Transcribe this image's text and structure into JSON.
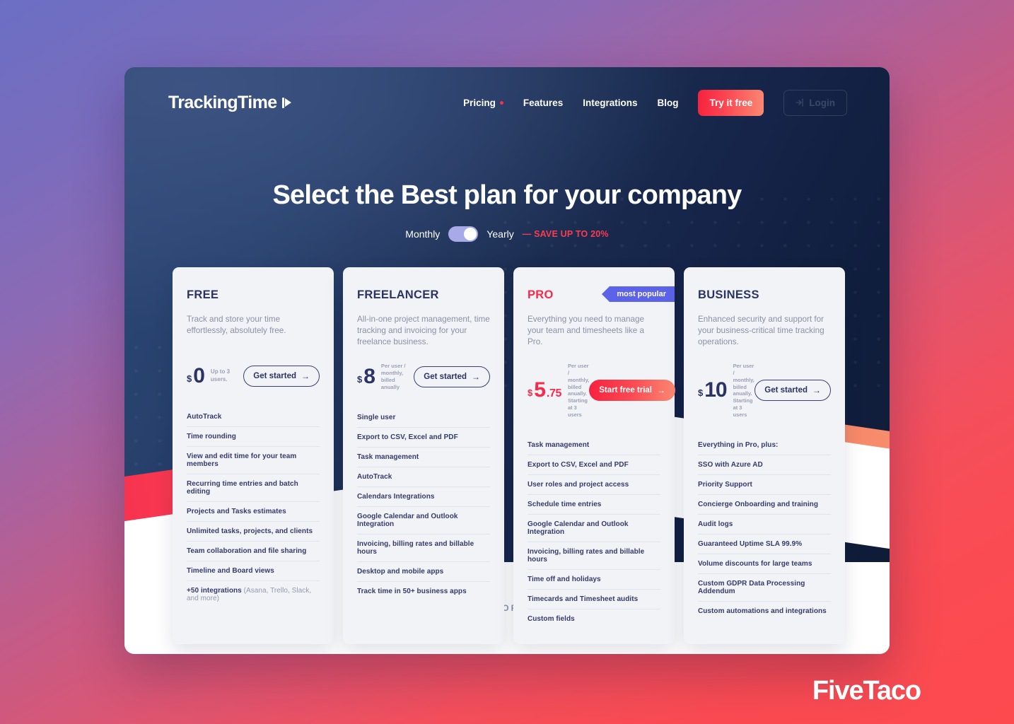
{
  "nav": {
    "logo": "TrackingTime",
    "links": [
      {
        "label": "Pricing",
        "has_dot": true
      },
      {
        "label": "Features",
        "has_dot": false
      },
      {
        "label": "Integrations",
        "has_dot": false
      },
      {
        "label": "Blog",
        "has_dot": false
      }
    ],
    "try_free": "Try it free",
    "login": "Login"
  },
  "hero": {
    "headline": "Select the Best plan for your company",
    "toggle": {
      "monthly_label": "Monthly",
      "yearly_label": "Yearly",
      "selected": "Yearly",
      "save_note": "— SAVE UP TO 20%"
    }
  },
  "plans": [
    {
      "name": "FREE",
      "accent": false,
      "badge": null,
      "description": "Track and store your time effortlessly, absolutely free.",
      "currency": "$",
      "amount": "0",
      "cents": "",
      "price_note": "Up to 3 users.",
      "cta": "Get started",
      "cta_filled": false,
      "features": [
        "AutoTrack",
        "Time rounding",
        "View and edit time for your team members",
        "Recurring time entries and batch editing",
        "Projects and Tasks estimates",
        "Unlimited tasks, projects, and clients",
        "Team collaboration and file sharing",
        "Timeline and Board views"
      ],
      "last_feature": {
        "bold": "+50 integrations",
        "muted": "(Asana, Trello, Slack, and more)"
      }
    },
    {
      "name": "FREELANCER",
      "accent": false,
      "badge": null,
      "description": "All-in-one project management, time tracking and invoicing for your freelance business.",
      "currency": "$",
      "amount": "8",
      "cents": "",
      "price_note": "Per user / monthly, billed anually",
      "cta": "Get started",
      "cta_filled": false,
      "features": [
        "Single user",
        "Export to CSV, Excel and PDF",
        "Task management",
        "AutoTrack",
        "Calendars Integrations",
        "Google Calendar and Outlook Integration",
        "Invoicing, billing rates and billable hours",
        "Desktop and mobile apps",
        "Track time in 50+ business apps"
      ],
      "last_feature": null
    },
    {
      "name": "PRO",
      "accent": true,
      "badge": "most popular",
      "description": "Everything you need to manage your team and timesheets like a Pro.",
      "currency": "$",
      "amount": "5",
      "cents": ".75",
      "price_note": "Per user / monthly, billed anually. Starting at 3 users",
      "cta": "Start free trial",
      "cta_filled": true,
      "features": [
        "Task management",
        "Export to CSV, Excel and PDF",
        "User roles and project access",
        "Schedule time entries",
        "Google Calendar and Outlook Integration",
        "Invoicing, billing rates and billable hours",
        "Time off and holidays",
        "Timecards and Timesheet audits",
        "Custom fields"
      ],
      "last_feature": null
    },
    {
      "name": "BUSINESS",
      "accent": false,
      "badge": null,
      "description": "Enhanced security and support for your business-critical time tracking operations.",
      "currency": "$",
      "amount": "10",
      "cents": "",
      "price_note": "Per user / monthly, billed anually. Starting at 3 users",
      "cta": "Get started",
      "cta_filled": false,
      "features": [
        "Everything in Pro, plus:",
        "SSO with Azure AD",
        "Priority Support",
        "Concierge Onboarding and training",
        "Audit logs",
        "Guaranteed Uptime SLA 99.9%",
        "Volume discounts for large teams",
        "Custom GDPR Data Processing Addendum",
        "Custom automations and integrations"
      ],
      "last_feature": null
    }
  ],
  "footer": {
    "trusted_text": "TRUSTED BY COMPANIES OF ALL SHAPES AND SIZES"
  },
  "watermark": {
    "brand": "FiveTaco"
  },
  "colors": {
    "accent_red": "#f8294a",
    "badge_purple": "#5d63e8",
    "dark_navy": "#16254a",
    "card_bg": "#f2f3f7",
    "title_navy": "#2b3363"
  }
}
